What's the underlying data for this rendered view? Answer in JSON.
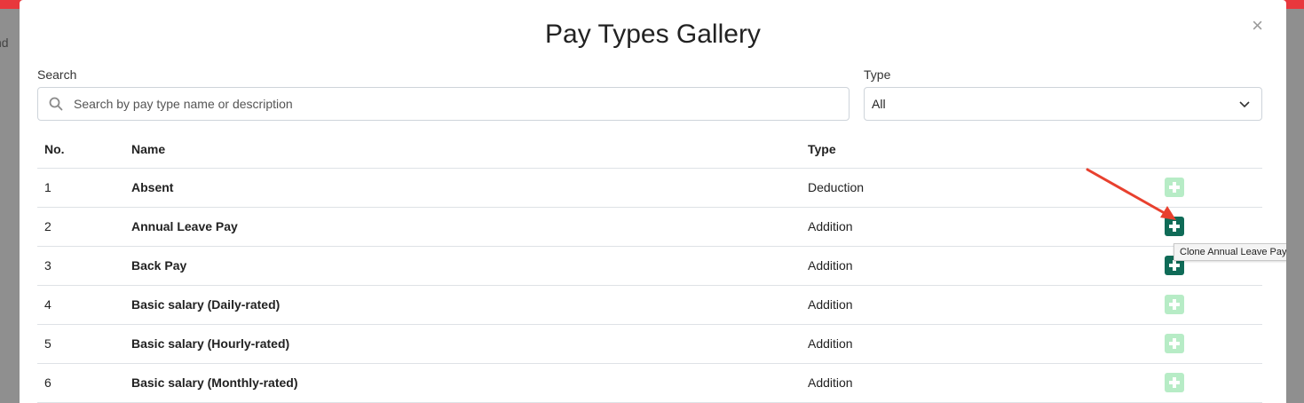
{
  "background": {
    "text": "nd"
  },
  "modal": {
    "title": "Pay Types Gallery",
    "close_glyph": "×"
  },
  "search": {
    "label": "Search",
    "placeholder": "Search by pay type name or description",
    "value": ""
  },
  "type_filter": {
    "label": "Type",
    "selected": "All"
  },
  "table": {
    "headers": {
      "no": "No.",
      "name": "Name",
      "type": "Type"
    },
    "rows": [
      {
        "no": "1",
        "name": "Absent",
        "type": "Deduction",
        "button_state": "light"
      },
      {
        "no": "2",
        "name": "Annual Leave Pay",
        "type": "Addition",
        "button_state": "dark"
      },
      {
        "no": "3",
        "name": "Back Pay",
        "type": "Addition",
        "button_state": "dark"
      },
      {
        "no": "4",
        "name": "Basic salary (Daily-rated)",
        "type": "Addition",
        "button_state": "light"
      },
      {
        "no": "5",
        "name": "Basic salary (Hourly-rated)",
        "type": "Addition",
        "button_state": "light"
      },
      {
        "no": "6",
        "name": "Basic salary (Monthly-rated)",
        "type": "Addition",
        "button_state": "light"
      }
    ]
  },
  "tooltip": {
    "text": "Clone Annual Leave Pay"
  },
  "colors": {
    "accent_dark": "#0f6b57",
    "accent_light": "#b7ecc6",
    "annotation_arrow": "#e8402e",
    "top_bar": "#e8383d"
  },
  "icons": {
    "search": "search-icon",
    "select": "chevron-down-icon",
    "close": "close-icon",
    "clone": "plus-square-icon"
  }
}
